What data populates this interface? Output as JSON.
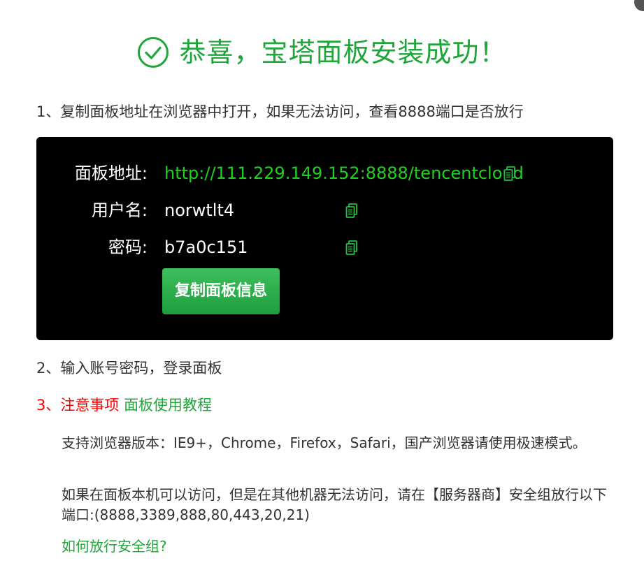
{
  "header": {
    "title": "恭喜，宝塔面板安装成功！",
    "accent_color": "#20a53a",
    "icon": "check-circle-icon"
  },
  "steps": {
    "step1": "1、复制面板地址在浏览器中打开，如果无法访问，查看8888端口是否放行",
    "step2": "2、输入账号密码，登录面板",
    "step3_notice": "3、注意事项",
    "step3_link": "面板使用教程"
  },
  "panel": {
    "address_label": "面板地址:",
    "address_value": "http://111.229.149.152:8888/tencentcloud",
    "username_label": "用户名:",
    "username_value": "norwtlt4",
    "password_label": "密码:",
    "password_value": "b7a0c151",
    "copy_icon": "copy-icon",
    "copy_button_label": "复制面板信息",
    "url_color": "#20d020"
  },
  "notes": {
    "browser_support": "支持浏览器版本：IE9+，Chrome，Firefox，Safari，国产浏览器请使用极速模式。",
    "port_notice": "如果在面板本机可以访问，但是在其他机器无法访问，请在【服务器商】安全组放行以下端口:(8888,3389,888,80,443,20,21)",
    "security_group_link": "如何放行安全组?"
  }
}
